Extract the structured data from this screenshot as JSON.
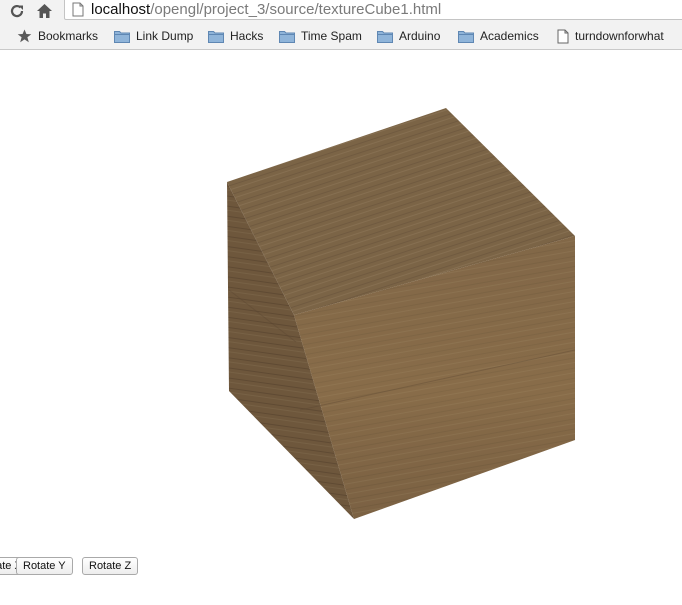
{
  "browser": {
    "url_host": "localhost",
    "url_path": "/opengl/project_3/source/textureCube1.html",
    "bookmarks": [
      {
        "label": "Bookmarks",
        "icon": "star-icon"
      },
      {
        "label": "Link Dump",
        "icon": "folder-icon"
      },
      {
        "label": "Hacks",
        "icon": "folder-icon"
      },
      {
        "label": "Time Spam",
        "icon": "folder-icon"
      },
      {
        "label": "Arduino",
        "icon": "folder-icon"
      },
      {
        "label": "Academics",
        "icon": "folder-icon"
      },
      {
        "label": "turndownforwhat",
        "icon": "page-icon"
      }
    ]
  },
  "page": {
    "buttons": [
      {
        "label": "Rotate X"
      },
      {
        "label": "Rotate Y"
      },
      {
        "label": "Rotate Z"
      }
    ]
  },
  "colors": {
    "wood_top": "#7b6446",
    "wood_left": "#6e573c",
    "wood_right": "#7f6546",
    "folder_blue": "#8fb4d9"
  }
}
